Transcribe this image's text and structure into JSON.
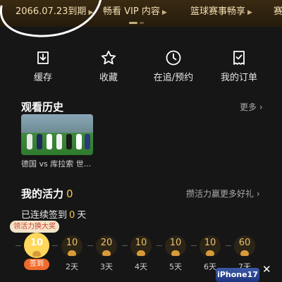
{
  "vip_bar": {
    "expiry": "2066.07.23到期",
    "item2": "畅看 VIP 内容",
    "item3": "篮球赛事畅享",
    "item4": "赛"
  },
  "quick_actions": [
    {
      "label": "缓存",
      "icon": "download-icon"
    },
    {
      "label": "收藏",
      "icon": "star-icon"
    },
    {
      "label": "在追/预约",
      "icon": "clock-icon"
    },
    {
      "label": "我的订单",
      "icon": "order-icon"
    }
  ],
  "history": {
    "title": "观看历史",
    "more": "更多",
    "items": [
      {
        "caption": "德国 vs 库拉索 世..."
      }
    ]
  },
  "vitality": {
    "title": "我的活力",
    "score": "0",
    "link": "攒活力赢更多好礼",
    "streak_prefix": "已连续签到",
    "streak_days": "0",
    "streak_suffix": "天",
    "reward_tag": "领活力换大奖",
    "sign_button": "签到",
    "days": [
      {
        "points": "10",
        "label": ""
      },
      {
        "points": "10",
        "label": "2天"
      },
      {
        "points": "20",
        "label": "3天"
      },
      {
        "points": "10",
        "label": "4天"
      },
      {
        "points": "10",
        "label": "5天"
      },
      {
        "points": "10",
        "label": "6天"
      },
      {
        "points": "60",
        "label": "7天"
      }
    ]
  },
  "overlay": {
    "badge": "iPhone17",
    "close": "✕"
  },
  "colors": {
    "background": "#161616",
    "gold": "#f1c84c",
    "vip_text": "#f3dfb3",
    "sign_orange": "#f06a2a"
  }
}
